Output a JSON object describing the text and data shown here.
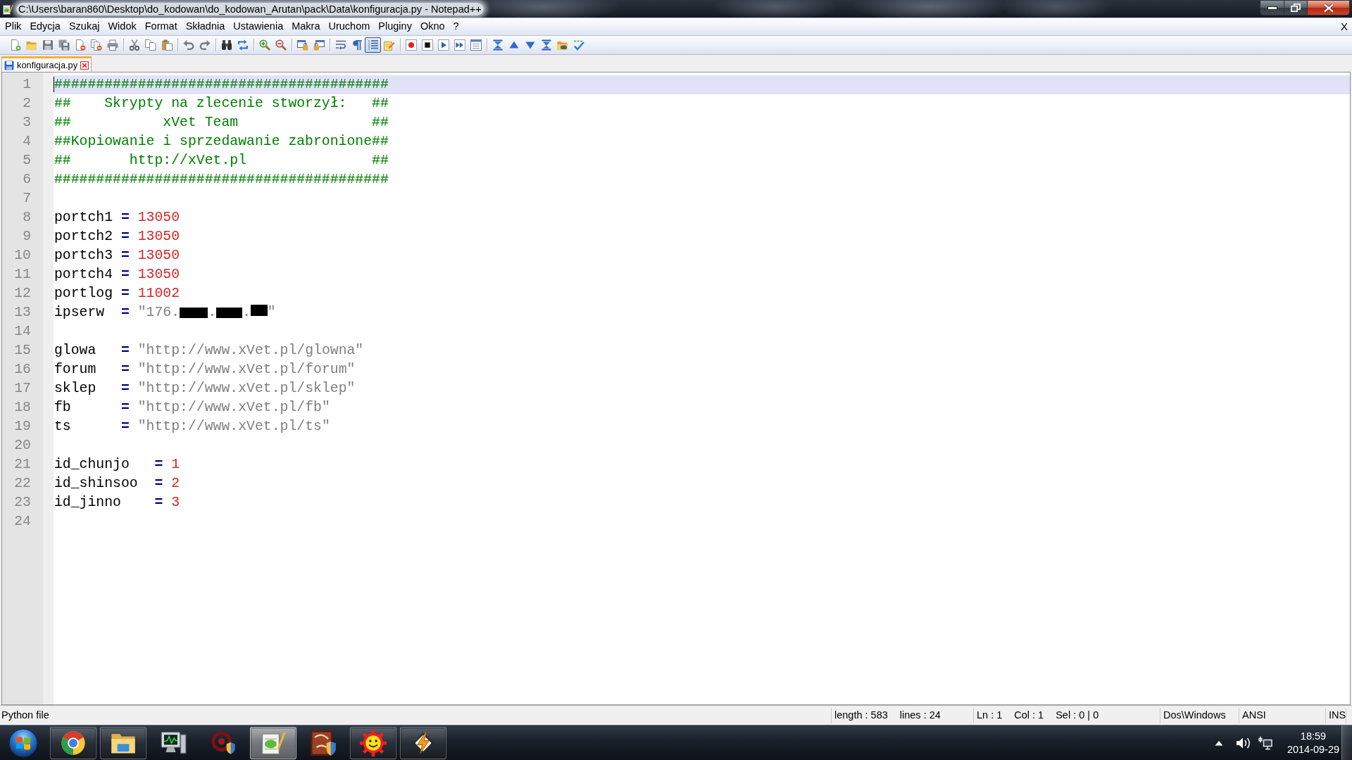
{
  "window": {
    "title": "C:\\Users\\baran860\\Desktop\\do_kodowan\\do_kodowan_Arutan\\pack\\Data\\konfiguracja.py - Notepad++"
  },
  "menu": {
    "items": [
      "Plik",
      "Edycja",
      "Szukaj",
      "Widok",
      "Format",
      "Składnia",
      "Ustawienia",
      "Makra",
      "Uruchom",
      "Pluginy",
      "Okno",
      "?"
    ],
    "close": "X"
  },
  "toolbar": [
    {
      "pressed": false
    },
    {
      "pressed": false
    },
    {
      "pressed": false
    },
    {
      "pressed": false
    },
    {
      "pressed": false
    },
    {
      "pressed": false
    },
    {
      "pressed": false
    },
    {
      "pressed": false
    },
    {
      "pressed": false
    },
    {
      "pressed": false
    },
    {
      "pressed": false
    },
    {
      "pressed": false
    },
    {
      "pressed": false
    },
    {
      "pressed": false
    },
    {
      "pressed": false
    },
    {
      "pressed": false
    },
    {
      "pressed": false
    },
    {
      "pressed": false
    },
    {
      "pressed": false
    },
    {
      "pressed": false
    },
    {
      "pressed": true
    },
    {
      "pressed": false
    },
    {
      "pressed": false
    },
    {
      "pressed": false
    },
    {
      "pressed": false
    },
    {
      "pressed": false
    },
    {
      "pressed": false
    },
    {
      "pressed": false
    },
    {
      "pressed": false
    },
    {
      "pressed": false
    },
    {
      "pressed": false
    },
    {
      "pressed": false
    },
    {
      "pressed": false
    }
  ],
  "tabs": [
    {
      "label": "konfiguracja.py",
      "selected": true
    }
  ],
  "editor": {
    "lines": [
      {
        "number": "1",
        "current": true,
        "tokens": [
          {
            "kind": "comment",
            "text": "########################################"
          }
        ]
      },
      {
        "number": "2",
        "current": false,
        "tokens": [
          {
            "kind": "comment",
            "text": "##    Skrypty na zlecenie stworzył:   ##"
          }
        ]
      },
      {
        "number": "3",
        "current": false,
        "tokens": [
          {
            "kind": "comment",
            "text": "##           xVet Team                ##"
          }
        ]
      },
      {
        "number": "4",
        "current": false,
        "tokens": [
          {
            "kind": "comment",
            "text": "##Kopiowanie i sprzedawanie zabronione##"
          }
        ]
      },
      {
        "number": "5",
        "current": false,
        "tokens": [
          {
            "kind": "comment",
            "text": "##       http://xVet.pl               ##"
          }
        ]
      },
      {
        "number": "6",
        "current": false,
        "tokens": [
          {
            "kind": "comment",
            "text": "########################################"
          }
        ]
      },
      {
        "number": "7",
        "current": false
      },
      {
        "number": "8",
        "current": false,
        "tokens": [
          {
            "kind": "identifier",
            "text": "portch1"
          },
          {
            "kind": "operator",
            "text": " ="
          },
          {
            "kind": "number",
            "text": " 13050"
          }
        ]
      },
      {
        "number": "9",
        "current": false,
        "tokens": [
          {
            "kind": "identifier",
            "text": "portch2"
          },
          {
            "kind": "operator",
            "text": " ="
          },
          {
            "kind": "number",
            "text": " 13050"
          }
        ]
      },
      {
        "number": "10",
        "current": false,
        "tokens": [
          {
            "kind": "identifier",
            "text": "portch3"
          },
          {
            "kind": "operator",
            "text": " ="
          },
          {
            "kind": "number",
            "text": " 13050"
          }
        ]
      },
      {
        "number": "11",
        "current": false,
        "tokens": [
          {
            "kind": "identifier",
            "text": "portch4"
          },
          {
            "kind": "operator",
            "text": " ="
          },
          {
            "kind": "number",
            "text": " 13050"
          }
        ]
      },
      {
        "number": "12",
        "current": false,
        "tokens": [
          {
            "kind": "identifier",
            "text": "portlog"
          },
          {
            "kind": "operator",
            "text": " ="
          },
          {
            "kind": "number",
            "text": " 11002"
          }
        ]
      },
      {
        "number": "13",
        "current": false,
        "tokens": [
          {
            "kind": "identifier",
            "text": "ipserw"
          },
          {
            "kind": "operator",
            "text": "  ="
          },
          {
            "kind": "string",
            "text": " \"176."
          },
          {
            "kind": "redacted"
          },
          {
            "kind": "string",
            "text": "."
          },
          {
            "kind": "redacted"
          },
          {
            "kind": "string",
            "text": "."
          },
          {
            "kind": "redacted"
          },
          {
            "kind": "string",
            "text": "\""
          }
        ]
      },
      {
        "number": "14",
        "current": false
      },
      {
        "number": "15",
        "current": false,
        "tokens": [
          {
            "kind": "identifier",
            "text": "glowa"
          },
          {
            "kind": "operator",
            "text": "   ="
          },
          {
            "kind": "string",
            "text": " \"http://www.xVet.pl/glowna\""
          }
        ]
      },
      {
        "number": "16",
        "current": false,
        "tokens": [
          {
            "kind": "identifier",
            "text": "forum"
          },
          {
            "kind": "operator",
            "text": "   ="
          },
          {
            "kind": "string",
            "text": " \"http://www.xVet.pl/forum\""
          }
        ]
      },
      {
        "number": "17",
        "current": false,
        "tokens": [
          {
            "kind": "identifier",
            "text": "sklep"
          },
          {
            "kind": "operator",
            "text": "   ="
          },
          {
            "kind": "string",
            "text": " \"http://www.xVet.pl/sklep\""
          }
        ]
      },
      {
        "number": "18",
        "current": false,
        "tokens": [
          {
            "kind": "identifier",
            "text": "fb"
          },
          {
            "kind": "operator",
            "text": "      ="
          },
          {
            "kind": "string",
            "text": " \"http://www.xVet.pl/fb\""
          }
        ]
      },
      {
        "number": "19",
        "current": false,
        "tokens": [
          {
            "kind": "identifier",
            "text": "ts"
          },
          {
            "kind": "operator",
            "text": "      ="
          },
          {
            "kind": "string",
            "text": " \"http://www.xVet.pl/ts\""
          }
        ]
      },
      {
        "number": "20",
        "current": false
      },
      {
        "number": "21",
        "current": false,
        "tokens": [
          {
            "kind": "identifier",
            "text": "id_chunjo"
          },
          {
            "kind": "operator",
            "text": "   ="
          },
          {
            "kind": "number",
            "text": " 1"
          }
        ]
      },
      {
        "number": "22",
        "current": false,
        "tokens": [
          {
            "kind": "identifier",
            "text": "id_shinsoo"
          },
          {
            "kind": "operator",
            "text": "  ="
          },
          {
            "kind": "number",
            "text": " 2"
          }
        ]
      },
      {
        "number": "23",
        "current": false,
        "tokens": [
          {
            "kind": "identifier",
            "text": "id_jinno"
          },
          {
            "kind": "operator",
            "text": "    ="
          },
          {
            "kind": "number",
            "text": " 3"
          }
        ]
      },
      {
        "number": "24",
        "current": false
      }
    ]
  },
  "status_bar": {
    "file_type": "Python file",
    "length": "length : 583",
    "lines": "lines : 24",
    "line": "Ln : 1",
    "column": "Col : 1",
    "selection": "Sel : 0 | 0",
    "line_endings": "Dos\\Windows",
    "encoding": "ANSI",
    "mode": "INS"
  },
  "taskbar": {
    "items": [
      {
        "running": true,
        "selected": false
      },
      {
        "running": true,
        "selected": false
      },
      {
        "running": false,
        "selected": false
      },
      {
        "running": false,
        "selected": false
      },
      {
        "running": true,
        "selected": true
      },
      {
        "running": false,
        "selected": false
      },
      {
        "running": true,
        "selected": false
      },
      {
        "running": true,
        "selected": false
      }
    ],
    "clock": {
      "time": "18:59",
      "date": "2014-09-29"
    }
  }
}
